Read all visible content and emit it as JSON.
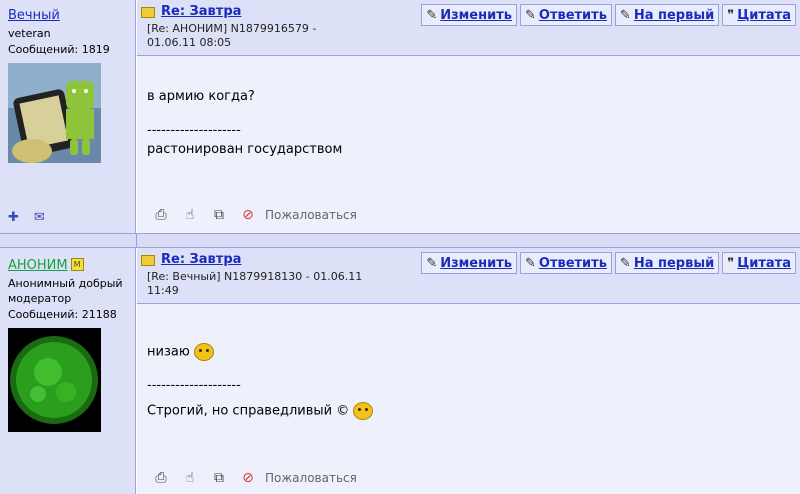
{
  "posts": [
    {
      "author": {
        "name": "Вечный",
        "rank": "veteran",
        "messages": "Сообщений: 1819",
        "moderator_badge": "",
        "rank_line2": ""
      },
      "title": "Re: Завтра",
      "meta": "[Re: АНОНИМ]  N1879916579 - 01.06.11 08:05",
      "actions": [
        "Изменить",
        "Ответить",
        "На первый",
        "Цитата"
      ],
      "body": [
        "в армию когда?",
        "",
        "--------------------",
        "растонирован государством"
      ],
      "report_label": "Пожаловаться"
    },
    {
      "author": {
        "name": "АНОНИМ",
        "rank": "Анонимный добрый",
        "rank_line2": "модератор",
        "messages": "Сообщений: 21188",
        "moderator_badge": "M"
      },
      "title": "Re: Завтра",
      "meta": "[Re: Вечный]  N1879918130 - 01.06.11 11:49",
      "actions": [
        "Изменить",
        "Ответить",
        "На первый",
        "Цитата"
      ],
      "body": [
        "низаю",
        "",
        "--------------------",
        "Строгий, но справедливый ©"
      ],
      "report_label": "Пожаловаться"
    }
  ],
  "icons": {
    "title": "book-icon",
    "edit": "pencil-icon",
    "reply": "reply-icon",
    "first": "pencil-icon",
    "quote": "quote-icon",
    "print": "printer-icon",
    "hand": "hand-icon",
    "forward": "forward-icon",
    "report": "report-icon",
    "add_user": "add-user-icon",
    "email": "email-icon"
  }
}
